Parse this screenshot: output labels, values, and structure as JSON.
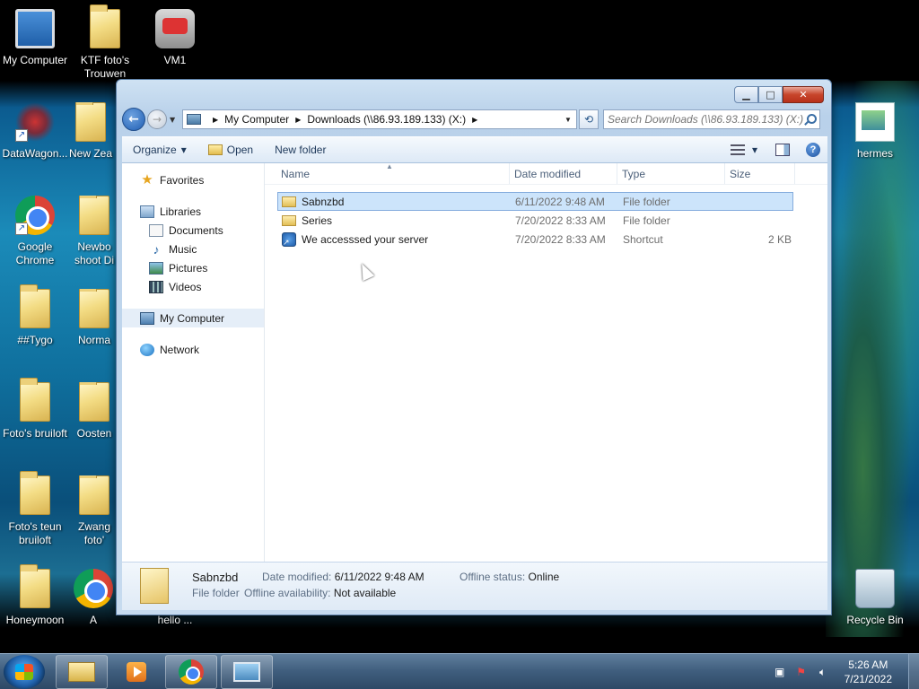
{
  "desktop": {
    "icons": [
      {
        "label": "My Computer",
        "icon": "computer-icon"
      },
      {
        "label": "KTF foto's Trouwen",
        "icon": "folder-icon"
      },
      {
        "label": "VM1",
        "icon": "vm-icon"
      },
      {
        "label": "DataWagon...",
        "icon": "datawagon-icon"
      },
      {
        "label": "New Zea",
        "icon": "folder-icon"
      },
      {
        "label": "hermes",
        "icon": "image-file-icon"
      },
      {
        "label": "Google Chrome",
        "icon": "chrome-icon"
      },
      {
        "label": "Newbo shoot Di",
        "icon": "folder-icon"
      },
      {
        "label": "##Tygo",
        "icon": "folder-icon"
      },
      {
        "label": "Norma",
        "icon": "folder-icon"
      },
      {
        "label": "Foto's bruiloft",
        "icon": "folder-icon"
      },
      {
        "label": "Oosten",
        "icon": "folder-icon"
      },
      {
        "label": "Foto's teun bruiloft",
        "icon": "folder-icon"
      },
      {
        "label": "Zwang foto'",
        "icon": "folder-icon"
      },
      {
        "label": "Honeymoon",
        "icon": "folder-icon"
      },
      {
        "label": "A",
        "icon": "chrome-icon"
      },
      {
        "label": "hello ...",
        "icon": "file-icon"
      },
      {
        "label": "Recycle Bin",
        "icon": "recycle-bin-icon"
      }
    ]
  },
  "window": {
    "minimize": "▁",
    "maximize": "□",
    "close": "✕",
    "nav": {
      "back": "←",
      "forward": "→",
      "dropdown": "▼"
    },
    "address": {
      "crumbs": [
        "My Computer",
        "Downloads (\\\\86.93.189.133) (X:)"
      ],
      "separator": "▶",
      "dropdown": "▼",
      "refresh": "⟲"
    },
    "search": {
      "placeholder": "Search Downloads (\\\\86.93.189.133) (X:)"
    },
    "toolbar": {
      "organize": "Organize",
      "organize_arrow": "▾",
      "open": "Open",
      "new_folder": "New folder",
      "views_arrow": "▾",
      "help": "?"
    },
    "navpane": {
      "favorites": "Favorites",
      "libraries": "Libraries",
      "library_items": [
        "Documents",
        "Music",
        "Pictures",
        "Videos"
      ],
      "my_computer": "My Computer",
      "network": "Network"
    },
    "columns": {
      "name": "Name",
      "date": "Date modified",
      "type": "Type",
      "size": "Size",
      "sort_indicator": "▲"
    },
    "files": [
      {
        "name": "Sabnzbd",
        "date": "6/11/2022 9:48 AM",
        "type": "File folder",
        "size": "",
        "icon": "folder-icon",
        "selected": true
      },
      {
        "name": "Series",
        "date": "7/20/2022 8:33 AM",
        "type": "File folder",
        "size": "",
        "icon": "folder-icon",
        "selected": false
      },
      {
        "name": "We accesssed your server",
        "date": "7/20/2022 8:33 AM",
        "type": "Shortcut",
        "size": "2 KB",
        "icon": "shortcut-icon",
        "selected": false
      }
    ],
    "details": {
      "name": "Sabnzbd",
      "type": "File folder",
      "date_label": "Date modified:",
      "date_value": "6/11/2022 9:48 AM",
      "offline_status_label": "Offline status:",
      "offline_status_value": "Online",
      "offline_avail_label": "Offline availability:",
      "offline_avail_value": "Not available"
    }
  },
  "taskbar": {
    "apps": [
      "windows-explorer-icon",
      "media-player-icon",
      "chrome-icon",
      "picture-viewer-icon"
    ],
    "tray": {
      "time": "5:26 AM",
      "date": "7/21/2022"
    }
  },
  "colors": {
    "selection": "#cce4fb",
    "selection_border": "#84acdd",
    "accent": "#1f5eb3"
  }
}
